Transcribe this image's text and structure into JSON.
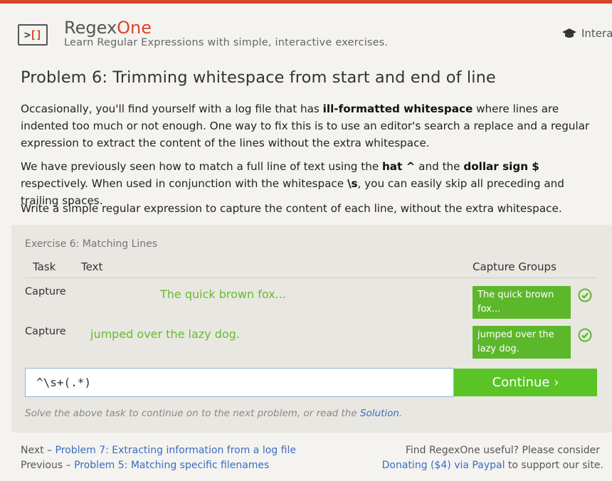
{
  "header": {
    "logo_text_left": ">",
    "logo_text_bracket": "[]",
    "brand_main": "Regex",
    "brand_accent": "One",
    "tagline": "Learn Regular Expressions with simple, interactive exercises.",
    "nav_item": "Intera"
  },
  "problem": {
    "title": "Problem 6: Trimming whitespace from start and end of line",
    "p1_a": "Occasionally, you'll find yourself with a log file that has ",
    "p1_b": "ill-formatted whitespace",
    "p1_c": " where lines are indented too much or not enough. One way to fix this is to use an editor's search a replace and a regular expression to extract the content of the lines without the extra whitespace.",
    "p2_a": "We have previously seen how to match a full line of text using the ",
    "p2_b": "hat ^",
    "p2_c": " and the ",
    "p2_d": "dollar sign $",
    "p2_e": " respectively. When used in conjunction with the whitespace ",
    "p2_f": "\\s",
    "p2_g": ", you can easily skip all preceding and trailing spaces.",
    "p3": "Write a simple regular expression to capture the content of each line, without the extra whitespace."
  },
  "exercise": {
    "label": "Exercise 6: Matching Lines",
    "headers": {
      "task": "Task",
      "text": "Text",
      "capture": "Capture Groups"
    },
    "rows": [
      {
        "task": "Capture",
        "text": "The quick brown fox...",
        "capture": "The quick brown fox...",
        "status": "check-circle-icon"
      },
      {
        "task": "Capture",
        "text": "jumped over the lazy dog.",
        "capture": "jumped over the lazy dog.",
        "status": "check-circle-icon"
      }
    ],
    "input_value": "^\\s+(.*)",
    "continue_label": "Continue ›",
    "hint_text": "Solve the above task to continue on to the next problem, or read the ",
    "hint_link": "Solution",
    "hint_end": "."
  },
  "footer": {
    "next_prefix": "Next – ",
    "next_link": "Problem 7: Extracting information from a log file",
    "prev_prefix": "Previous – ",
    "prev_link": "Problem 5: Matching specific filenames",
    "find_text": "Find RegexOne useful? Please consider",
    "donate_link": "Donating ($4) via Paypal",
    "donate_suffix": " to support our site."
  },
  "colors": {
    "accent": "#d6452a",
    "success": "#5cb82a",
    "link": "#3a6cc0",
    "match_text": "#66bb33"
  }
}
